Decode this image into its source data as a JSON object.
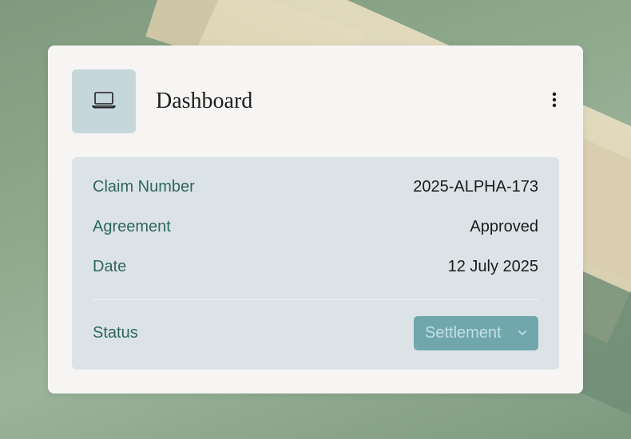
{
  "header": {
    "title": "Dashboard",
    "icon": "laptop-icon",
    "menu_icon": "more-vertical-icon"
  },
  "details": {
    "rows": [
      {
        "label": "Claim Number",
        "value": "2025-ALPHA-173"
      },
      {
        "label": "Agreement",
        "value": "Approved"
      },
      {
        "label": "Date",
        "value": "12 July 2025"
      }
    ],
    "status": {
      "label": "Status",
      "selected": "Settlement",
      "icon": "chevron-down-icon"
    }
  },
  "colors": {
    "card_bg": "#f6f5f3",
    "panel_bg": "#dbe3e7",
    "label_text": "#2f6758",
    "select_bg": "#6fa7ad",
    "icon_tile_bg": "#c6d7db"
  }
}
